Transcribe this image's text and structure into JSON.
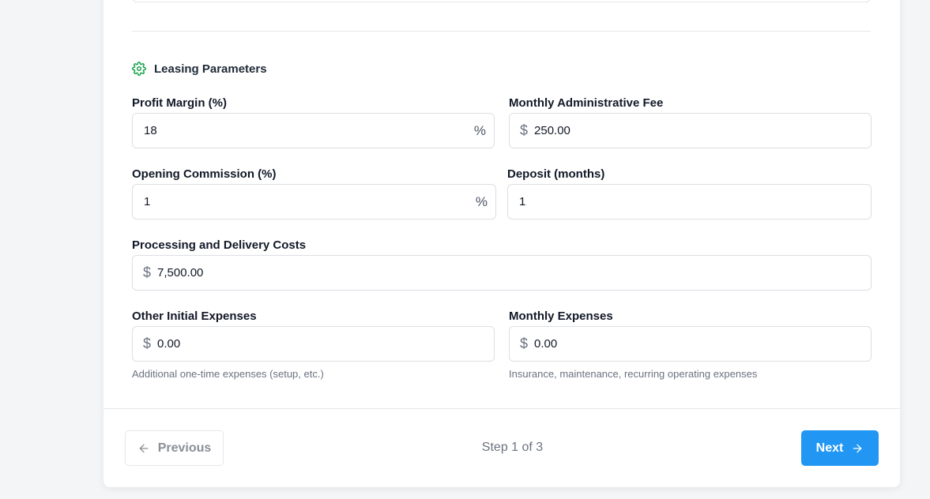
{
  "section": {
    "title": "Leasing Parameters",
    "icon": "gear-icon",
    "accent": "#16a34a"
  },
  "fields": {
    "profit_margin": {
      "label": "Profit Margin (%)",
      "value": "18",
      "suffix": "%"
    },
    "monthly_admin_fee": {
      "label": "Monthly Administrative Fee",
      "prefix": "$",
      "value": "250.00"
    },
    "opening_commission": {
      "label": "Opening Commission (%)",
      "value": "1",
      "suffix": "%"
    },
    "deposit_months": {
      "label": "Deposit (months)",
      "value": "1"
    },
    "processing_delivery": {
      "label": "Processing and Delivery Costs",
      "prefix": "$",
      "value": "7,500.00"
    },
    "other_initial": {
      "label": "Other Initial Expenses",
      "prefix": "$",
      "value": "0.00",
      "help": "Additional one-time expenses (setup, etc.)"
    },
    "monthly_expenses": {
      "label": "Monthly Expenses",
      "prefix": "$",
      "value": "0.00",
      "help": "Insurance, maintenance, recurring operating expenses"
    }
  },
  "footer": {
    "previous_label": "Previous",
    "step_text": "Step 1 of 3",
    "next_label": "Next",
    "next_color": "#2196f3"
  }
}
